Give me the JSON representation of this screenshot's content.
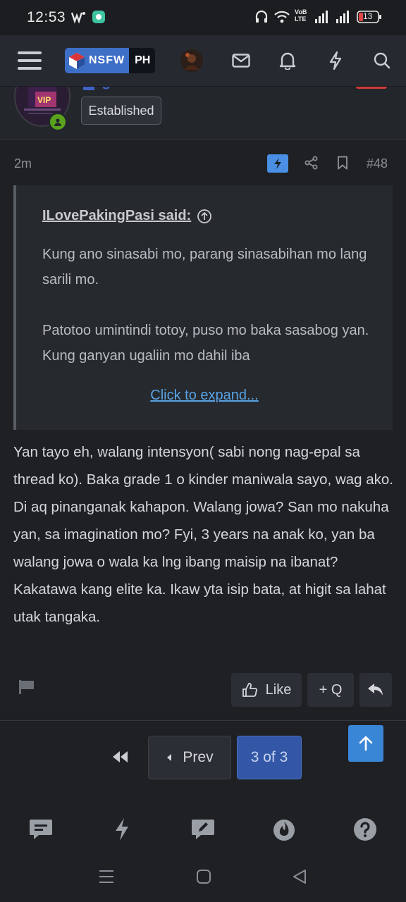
{
  "status_bar": {
    "time": "12:53",
    "battery": "13",
    "icons": [
      "wechat-icon",
      "chat-bubble-icon",
      "headphones-icon",
      "wifi-icon",
      "volte-icon",
      "signal-icon",
      "signal-icon",
      "battery-icon"
    ],
    "volte_label_1": "VoB",
    "volte_label_2": "LTE"
  },
  "top_nav": {
    "menu_icon": "hamburger-icon",
    "logo_part1": "NSFW",
    "logo_part2": "PH",
    "icons": [
      "user-avatar",
      "mail-icon",
      "bell-icon",
      "bolt-icon",
      "search-icon"
    ]
  },
  "post_header": {
    "username_fragment": "gnalatoo",
    "user_badge": "Established",
    "avatar_label": "VIP"
  },
  "post": {
    "time_ago": "2m",
    "post_number": "#48",
    "quote": {
      "author_line": "ILovePakingPasi said:",
      "paragraphs": [
        "Kung ano sinasabi mo, parang sinasabihan mo lang sarili mo.",
        "Patotoo umintindi totoy, puso mo baka sasabog yan.\nKung ganyan ugaliin mo dahil iba"
      ],
      "expand_label": "Click to expand..."
    },
    "message": "Yan tayo eh, walang intensyon( sabi nong nag-epal sa thread ko). Baka grade 1 o kinder maniwala sayo, wag ako. Di aq pinanganak kahapon. Walang jowa? San mo nakuha yan, sa imagination mo? Fyi, 3 years na anak ko, yan ba walang jowa o wala ka lng ibang maisip na ibanat? Kakatawa kang elite ka. Ikaw yta isip bata, at higit sa lahat utak tangaka.",
    "actions": {
      "like_label": "Like",
      "quote_label": "+ Q"
    }
  },
  "pagination": {
    "prev_label": "Prev",
    "current_label": "3 of 3"
  },
  "colors": {
    "background": "#1e2024",
    "nav": "#262a30",
    "accent": "#3a86d6",
    "current_page": "#3357a6",
    "online": "#5aa21e",
    "link": "#58a3e6"
  }
}
